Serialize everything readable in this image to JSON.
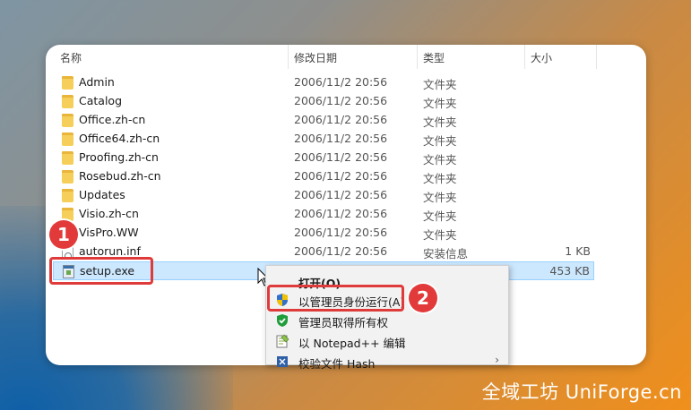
{
  "columns": {
    "name": "名称",
    "date": "修改日期",
    "type": "类型",
    "size": "大小"
  },
  "files": [
    {
      "name": "Admin",
      "date": "2006/11/2 20:56",
      "type": "文件夹",
      "size": "",
      "icon": "folder-icon"
    },
    {
      "name": "Catalog",
      "date": "2006/11/2 20:56",
      "type": "文件夹",
      "size": "",
      "icon": "folder-icon"
    },
    {
      "name": "Office.zh-cn",
      "date": "2006/11/2 20:56",
      "type": "文件夹",
      "size": "",
      "icon": "folder-icon"
    },
    {
      "name": "Office64.zh-cn",
      "date": "2006/11/2 20:56",
      "type": "文件夹",
      "size": "",
      "icon": "folder-icon"
    },
    {
      "name": "Proofing.zh-cn",
      "date": "2006/11/2 20:56",
      "type": "文件夹",
      "size": "",
      "icon": "folder-icon"
    },
    {
      "name": "Rosebud.zh-cn",
      "date": "2006/11/2 20:56",
      "type": "文件夹",
      "size": "",
      "icon": "folder-icon"
    },
    {
      "name": "Updates",
      "date": "2006/11/2 20:56",
      "type": "文件夹",
      "size": "",
      "icon": "folder-icon"
    },
    {
      "name": "Visio.zh-cn",
      "date": "2006/11/2 20:56",
      "type": "文件夹",
      "size": "",
      "icon": "folder-icon"
    },
    {
      "name": "VisPro.WW",
      "date": "2006/11/2 20:56",
      "type": "文件夹",
      "size": "",
      "icon": "folder-icon"
    },
    {
      "name": "autorun.inf",
      "date": "2006/11/2 20:56",
      "type": "安装信息",
      "size": "1 KB",
      "icon": "inf-file-icon"
    },
    {
      "name": "setup.exe",
      "date": "",
      "type": "",
      "size": "453 KB",
      "icon": "exe-file-icon"
    }
  ],
  "context_menu": {
    "items": [
      {
        "label": "打开(O)",
        "icon": ""
      },
      {
        "label": "以管理员身份运行(A)",
        "icon": "uac-shield-icon"
      },
      {
        "label": "管理员取得所有权",
        "icon": "green-shield-icon"
      },
      {
        "label": "以 Notepad++ 编辑",
        "icon": "notepad-plus-plus-icon"
      },
      {
        "label": "校验文件 Hash",
        "icon": "hash-icon"
      }
    ]
  },
  "annotations": {
    "step1": "1",
    "step2": "2"
  },
  "watermark": "全域工坊 UniForge.cn",
  "colors": {
    "highlight_red": "#e03b3b",
    "selection": "#cce8ff",
    "folder": "#f5cf5a"
  }
}
